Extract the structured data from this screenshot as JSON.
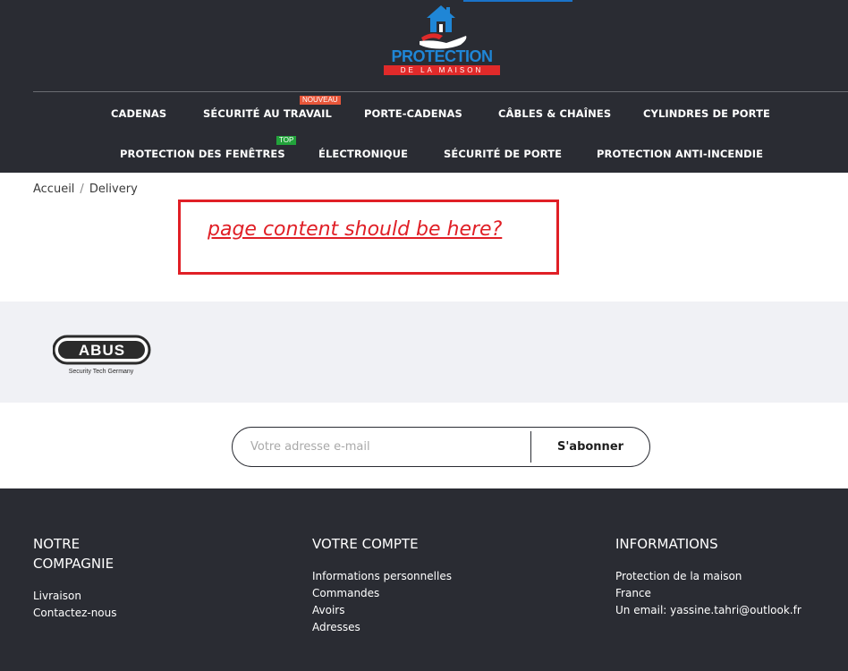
{
  "logo": {
    "word": "PROTECTION",
    "sub": "DE LA MAISON"
  },
  "nav": {
    "row1": [
      {
        "label": "CADENAS"
      },
      {
        "label": "SÉCURITÉ AU TRAVAIL",
        "badge": "NOUVEAU"
      },
      {
        "label": "PORTE-CADENAS"
      },
      {
        "label": "CÂBLES & CHAÎNES"
      },
      {
        "label": "CYLINDRES DE PORTE"
      }
    ],
    "row2": [
      {
        "label": "PROTECTION DES FENÊTRES",
        "badge": "TOP"
      },
      {
        "label": "ÉLECTRONIQUE"
      },
      {
        "label": "SÉCURITÉ DE PORTE"
      },
      {
        "label": "PROTECTION ANTI-INCENDIE"
      }
    ]
  },
  "breadcrumb": {
    "home": "Accueil",
    "separator": "/",
    "current": "Delivery"
  },
  "annotation": {
    "text": "page content should be here?",
    "color": "#e01f26"
  },
  "brands": {
    "abus_name": "ABUS",
    "abus_tagline": "Security Tech Germany"
  },
  "newsletter": {
    "placeholder": "Votre adresse e-mail",
    "button": "S'abonner"
  },
  "footer": {
    "company": {
      "title_line1": "NOTRE",
      "title_line2": "COMPAGNIE",
      "links": [
        "Livraison",
        "Contactez-nous"
      ]
    },
    "account": {
      "title": "VOTRE COMPTE",
      "links": [
        "Informations personnelles",
        "Commandes",
        "Avoirs",
        "Adresses"
      ]
    },
    "info": {
      "title": "INFORMATIONS",
      "lines": [
        "Protection de la maison",
        "France",
        "Un email: yassine.tahri@outlook.fr"
      ]
    }
  },
  "colors": {
    "header_bg": "#2a2c33",
    "accent_red": "#e01f26",
    "badge_new": "#e8563a",
    "badge_top": "#22a33b",
    "logo_blue": "#1f86d6"
  }
}
